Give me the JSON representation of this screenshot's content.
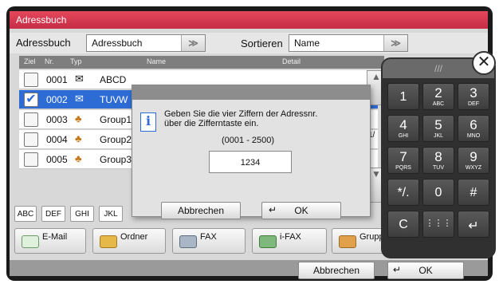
{
  "window": {
    "title": "Adressbuch"
  },
  "toolbar": {
    "adressbuch_label": "Adressbuch",
    "adressbuch_value": "Adressbuch",
    "sort_label": "Sortieren",
    "sort_value": "Name"
  },
  "table": {
    "headers": {
      "ziel": "Ziel",
      "nr": "Nr.",
      "typ": "Typ",
      "name": "Name",
      "detail": "Detail"
    },
    "rows": [
      {
        "nr": "0001",
        "name": "ABCD",
        "type_icon": "email-icon",
        "checked": false
      },
      {
        "nr": "0002",
        "name": "TUVW",
        "type_icon": "email-icon",
        "checked": true
      },
      {
        "nr": "0003",
        "name": "Group1",
        "type_icon": "group-icon",
        "checked": false
      },
      {
        "nr": "0004",
        "name": "Group2",
        "type_icon": "group-icon",
        "checked": false
      },
      {
        "nr": "0005",
        "name": "Group3",
        "type_icon": "group-icon",
        "checked": false
      }
    ],
    "page_indicator": "1/"
  },
  "alpha_tabs": [
    "ABC",
    "DEF",
    "GHI",
    "JKL"
  ],
  "categories": [
    "E-Mail",
    "Ordner",
    "FAX",
    "i-FAX",
    "Gruppe"
  ],
  "footer": {
    "cancel": "Abbrechen",
    "ok": "OK"
  },
  "dialog": {
    "line1": "Geben Sie die vier Ziffern der Adressnr.",
    "line2": "über die Zifferntaste ein.",
    "range": "(0001 - 2500)",
    "value": "1234",
    "cancel": "Abbrechen",
    "ok": "OK"
  },
  "keypad": {
    "header": "///",
    "keys": [
      {
        "main": "1",
        "sub": ""
      },
      {
        "main": "2",
        "sub": "ABC"
      },
      {
        "main": "3",
        "sub": "DEF"
      },
      {
        "main": "4",
        "sub": "GHI"
      },
      {
        "main": "5",
        "sub": "JKL"
      },
      {
        "main": "6",
        "sub": "MNO"
      },
      {
        "main": "7",
        "sub": "PQRS"
      },
      {
        "main": "8",
        "sub": "TUV"
      },
      {
        "main": "9",
        "sub": "WXYZ"
      },
      {
        "main": "*/.",
        "sub": ""
      },
      {
        "main": "0",
        "sub": ""
      },
      {
        "main": "#",
        "sub": ""
      },
      {
        "main": "C",
        "sub": ""
      },
      {
        "main": "⋮⋮⋮",
        "sub": ""
      },
      {
        "main": "↵",
        "sub": ""
      }
    ]
  },
  "colors": {
    "title_bar": "#d23a52",
    "selected_row": "#2d6bd5",
    "keypad_bg": "#303030"
  }
}
